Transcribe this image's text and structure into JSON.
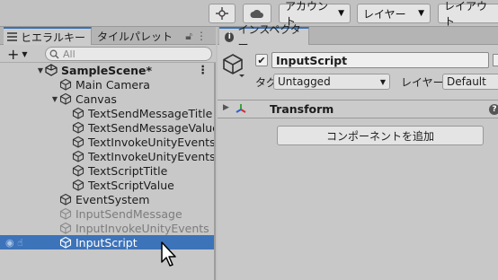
{
  "toolbar": {
    "account_label": "アカウント",
    "layers_label": "レイヤー",
    "layout_label": "レイアウト",
    "collab_icon": "collab-icon",
    "cloud_icon": "cloud-icon"
  },
  "hierarchy": {
    "tab_label": "ヒエラルキー",
    "tab2_label": "タイルパレット",
    "search_placeholder": "All",
    "scene_name": "SampleScene*",
    "items": [
      {
        "label": "Main Camera"
      },
      {
        "label": "Canvas"
      },
      {
        "label": "TextSendMessageTitle"
      },
      {
        "label": "TextSendMessageValue"
      },
      {
        "label": "TextInvokeUnityEventsT"
      },
      {
        "label": "TextInvokeUnityEventsV"
      },
      {
        "label": "TextScriptTitle"
      },
      {
        "label": "TextScriptValue"
      },
      {
        "label": "EventSystem"
      },
      {
        "label": "InputSendMessage"
      },
      {
        "label": "InputInvokeUnityEvents"
      },
      {
        "label": "InputScript"
      }
    ]
  },
  "inspector": {
    "tab_label": "インスペクター",
    "object_name": "InputScript",
    "tag_label": "タグ",
    "tag_value": "Untagged",
    "layer_label": "レイヤー",
    "layer_value": "Default",
    "component_title": "Transform",
    "add_component_label": "コンポーネントを追加"
  },
  "colors": {
    "selection": "#3d73b9",
    "tab_accent": "#3a72b0"
  }
}
